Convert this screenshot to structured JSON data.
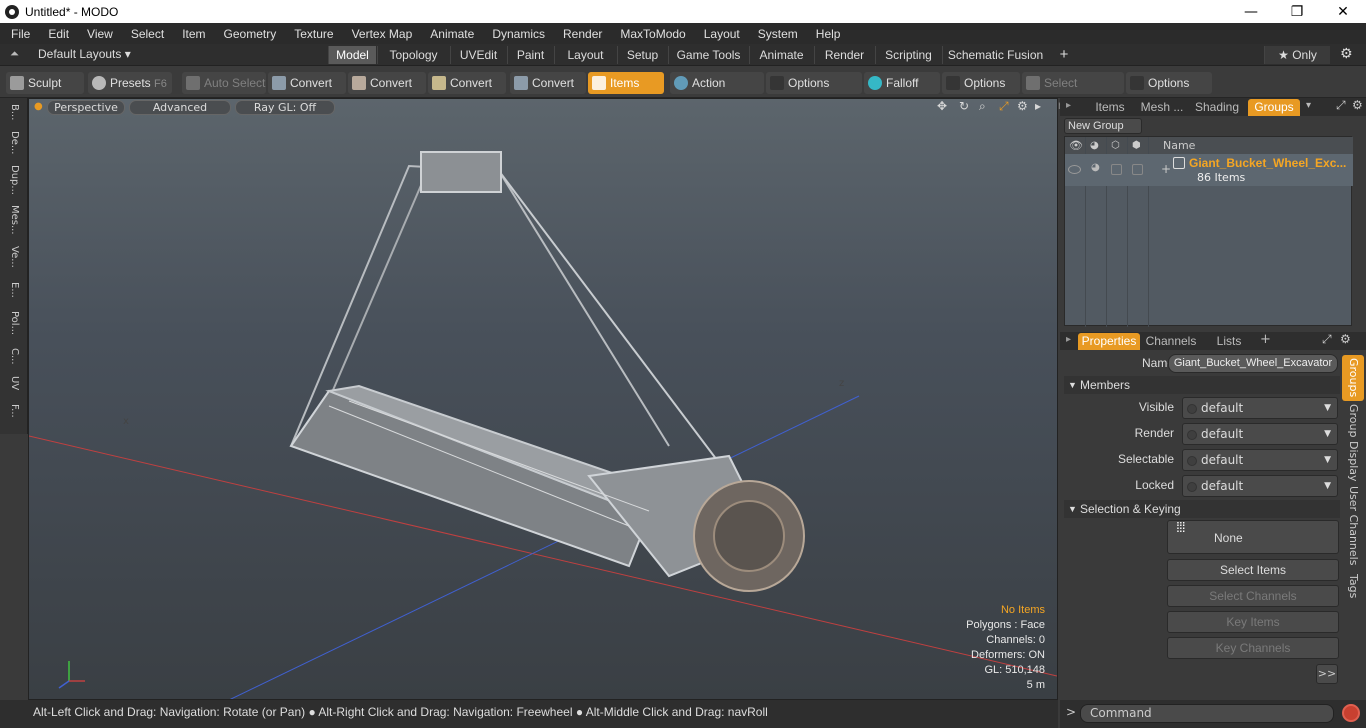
{
  "window": {
    "title": "Untitled* - MODO",
    "min": "—",
    "max": "❐",
    "close": "✕"
  },
  "menu": [
    "File",
    "Edit",
    "View",
    "Select",
    "Item",
    "Geometry",
    "Texture",
    "Vertex Map",
    "Animate",
    "Dynamics",
    "Render",
    "MaxToModo",
    "Layout",
    "System",
    "Help"
  ],
  "layoutbar": {
    "layouts_label": "Default Layouts ▾",
    "tabs": [
      "Model",
      "Topology",
      "UVEdit",
      "Paint",
      "Layout",
      "Setup",
      "Game Tools",
      "Animate",
      "Render",
      "Scripting",
      "Schematic Fusion"
    ],
    "active_tab": "Model",
    "add": "+",
    "only": "★  Only"
  },
  "toolbar": {
    "sculpt": "Sculpt",
    "presets": "Presets",
    "presets_key": "F6",
    "auto_select": "Auto Select",
    "convert1": "Convert",
    "convert2": "Convert",
    "convert3": "Convert",
    "convert4": "Convert",
    "items": "Items",
    "action_center": "Action Center",
    "options1": "Options",
    "falloff": "Falloff",
    "options2": "Options",
    "select_through": "Select Through",
    "options3": "Options"
  },
  "left_tabs": [
    "B...",
    "De...",
    "Dup...",
    "Mes...",
    "Ve...",
    "E...",
    "Pol...",
    "C...",
    "UV",
    "F..."
  ],
  "viewport": {
    "perspective": "Perspective",
    "advanced": "Advanced",
    "raygl": "Ray GL: Off",
    "info": {
      "no_items": "No Items",
      "polygons": "Polygons : Face",
      "channels": "Channels: 0",
      "deformers": "Deformers: ON",
      "gl": "GL: 510,148",
      "scale": "5 m"
    }
  },
  "status": "Alt-Left Click and Drag: Navigation: Rotate (or Pan) ● Alt-Right Click and Drag: Navigation: Freewheel ● Alt-Middle Click and Drag: navRoll",
  "rpanel": {
    "top_tabs": [
      "Items",
      "Mesh ...",
      "Shading",
      "Groups"
    ],
    "active_top_tab": "Groups",
    "new_group": "New Group",
    "list_header_name": "Name",
    "group_name": "Giant_Bucket_Wheel_Exc...",
    "group_count": "86 Items",
    "prop_tabs": [
      "Properties",
      "Channels",
      "Lists"
    ],
    "name_label": "Name",
    "name_value": "Giant_Bucket_Wheel_Excavator",
    "members_header": "Members",
    "members": [
      {
        "label": "Visible",
        "value": "default"
      },
      {
        "label": "Render",
        "value": "default"
      },
      {
        "label": "Selectable",
        "value": "default"
      },
      {
        "label": "Locked",
        "value": "default"
      }
    ],
    "selkey_header": "Selection & Keying",
    "none_label": "None",
    "select_items": "Select Items",
    "select_channels": "Select Channels",
    "key_items": "Key Items",
    "key_channels": "Key Channels",
    "more": ">>",
    "side_tabs": [
      "Groups",
      "Group Display",
      "User Channels",
      "Tags"
    ]
  },
  "command": {
    "placeholder": "Command"
  },
  "colors": {
    "accent": "#e89a23",
    "highlight_text": "#f5a623"
  }
}
